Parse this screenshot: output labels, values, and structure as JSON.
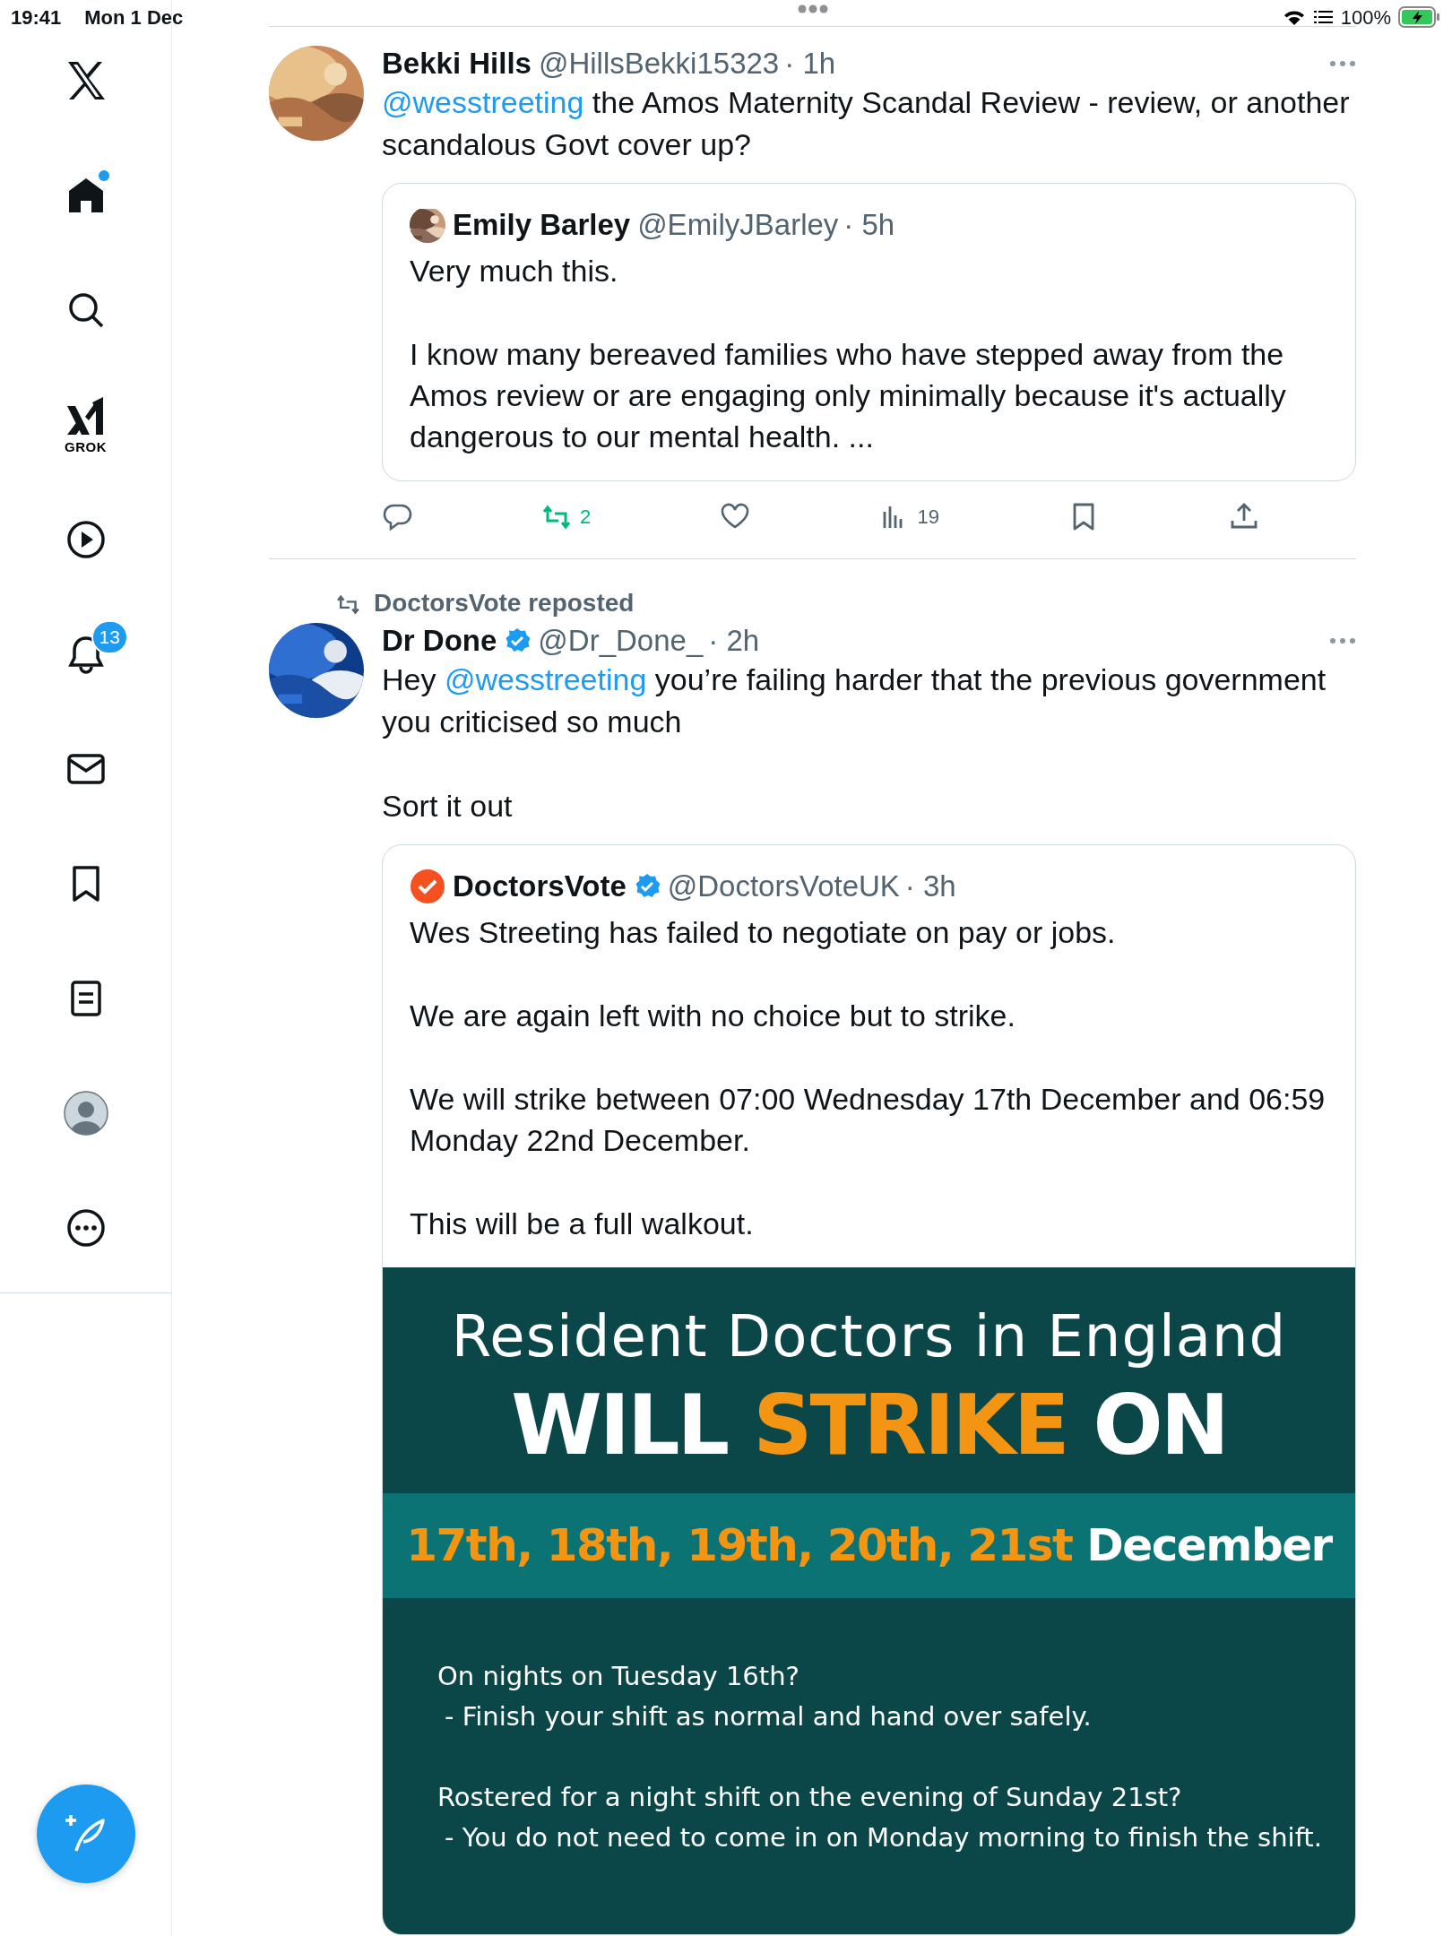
{
  "status_bar": {
    "time": "19:41",
    "date": "Mon 1 Dec",
    "battery": "100%",
    "charging": true
  },
  "sidebar": {
    "items": [
      {
        "kind": "logo"
      },
      {
        "kind": "home",
        "unread": true
      },
      {
        "kind": "search"
      },
      {
        "kind": "grok",
        "label": "GROK"
      },
      {
        "kind": "video"
      },
      {
        "kind": "notifications",
        "badge": "13"
      },
      {
        "kind": "messages"
      },
      {
        "kind": "bookmarks"
      },
      {
        "kind": "lists"
      },
      {
        "kind": "profile"
      },
      {
        "kind": "more"
      }
    ]
  },
  "tweets": [
    {
      "author": "Bekki Hills",
      "handle": "@HillsBekki15323",
      "time": "· 1h",
      "avatar": {
        "kind": "picture"
      },
      "paragraphs": [
        [
          {
            "kind": "mention",
            "text": "@wesstreeting"
          },
          {
            "kind": "text",
            "text": " the Amos Maternity Scandal Review - review, or another scandalous Govt cover up?"
          }
        ]
      ],
      "quote": {
        "author": "Emily Barley",
        "handle": "@EmilyJBarley",
        "time": "· 5h",
        "avatar": {
          "kind": "picture"
        },
        "paragraphs": [
          "Very much this.",
          "I know many bereaved families who have stepped away from the Amos review or are engaging only minimally because it's actually dangerous to our mental health. ..."
        ]
      },
      "actions": [
        {
          "kind": "reply",
          "on": false
        },
        {
          "kind": "repost",
          "count": "2",
          "on": true
        },
        {
          "kind": "like",
          "on": false
        },
        {
          "kind": "views",
          "count": "19",
          "on": false
        },
        {
          "kind": "bookmark",
          "on": false
        },
        {
          "kind": "share",
          "on": false
        }
      ]
    },
    {
      "reposted_by": "DoctorsVote reposted",
      "author": "Dr Done",
      "verified": true,
      "handle": "@Dr_Done_",
      "time": "· 2h",
      "avatar": {
        "kind": "picture"
      },
      "paragraphs": [
        [
          {
            "kind": "text",
            "text": "Hey "
          },
          {
            "kind": "mention",
            "text": "@wesstreeting"
          },
          {
            "kind": "text",
            "text": " you’re failing harder that the previous government you criticised so much"
          }
        ],
        [
          {
            "kind": "text",
            "text": "Sort it out"
          }
        ]
      ],
      "quote": {
        "author": "DoctorsVote",
        "verified": true,
        "handle": "@DoctorsVoteUK",
        "time": "· 3h",
        "avatar": {
          "kind": "logo"
        },
        "paragraphs": [
          "Wes Streeting has failed to negotiate on pay or jobs.",
          "We are again left with no choice but to strike.",
          "We will strike between 07:00 Wednesday 17th December and 06:59 Monday 22nd December.",
          "This will be a full walkout."
        ],
        "poster": {
          "headline": "Resident Doctors in England",
          "title": [
            {
              "text": "WILL ",
              "highlight": false
            },
            {
              "text": "STRIKE",
              "highlight": true
            },
            {
              "text": " ON",
              "highlight": false
            }
          ],
          "dates": [
            {
              "text": "17th, 18th, 19th, 20th, 21st ",
              "highlight": true
            },
            {
              "text": "December",
              "highlight": false
            }
          ],
          "notes": [
            {
              "question": "On nights on Tuesday 16th?",
              "answer": "- Finish your shift as normal and hand over safely."
            },
            {
              "question": "Rostered for a night shift on the evening of Sunday 21st?",
              "answer": "- You do not need to come in on Monday morning to finish the shift."
            }
          ]
        }
      }
    }
  ]
}
